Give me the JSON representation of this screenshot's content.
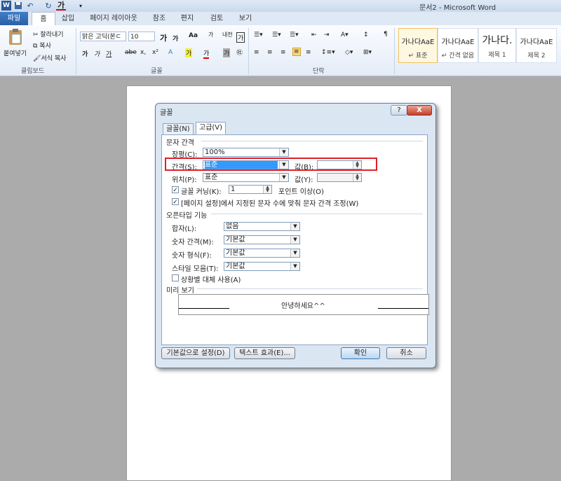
{
  "window": {
    "title": "문서2 - Microsoft Word"
  },
  "quick_access": {
    "icons": [
      "word-logo-icon",
      "save-icon",
      "undo-icon",
      "redo-icon",
      "font-color-icon",
      "customize-icon"
    ],
    "font_color_glyph": "가"
  },
  "ribbon_tabs": [
    "파일",
    "홈",
    "삽입",
    "페이지 레이아웃",
    "참조",
    "편지",
    "검토",
    "보기"
  ],
  "ribbon": {
    "clipboard": {
      "paste": "붙여넣기",
      "cut": "잘라내기",
      "copy": "복사",
      "format_painter": "서식 복사",
      "group": "클립보드"
    },
    "font": {
      "font_name": "맑은 고딕(본ㄷ",
      "font_size": "10",
      "group": "글꼴",
      "bold": "가",
      "italic": "가",
      "underline": "가",
      "strike": "abe",
      "sub": "x,",
      "sup": "x²",
      "grow": "가",
      "shrink": "가",
      "aa": "Aa",
      "clear": "가",
      "hanja": "내천",
      "border": "가",
      "shade": "가",
      "circle": "㊓",
      "color": "가",
      "highlight": "가"
    },
    "paragraph": {
      "group": "단락"
    },
    "styles": [
      {
        "sample": "가나다AaE",
        "name": "↵ 표준"
      },
      {
        "sample": "가나다AaE",
        "name": "↵ 간격 없음"
      },
      {
        "sample": "가나다.",
        "name": "제목 1"
      },
      {
        "sample": "가나다AaE",
        "name": "제목 2"
      }
    ]
  },
  "dialog": {
    "title": "글꼴",
    "help": "?",
    "close": "X",
    "tabs": [
      "글꼴(N)",
      "고급(V)"
    ],
    "char_spacing": {
      "section": "문자 간격",
      "scale_label": "장평(C):",
      "scale_value": "100%",
      "spacing_label": "간격(S):",
      "spacing_value": "표준",
      "spacing_by_label": "값(B):",
      "spacing_by_value": "",
      "position_label": "위치(P):",
      "position_value": "표준",
      "position_by_label": "값(Y):",
      "position_by_value": "",
      "kerning_label": "글꼴 커닝(K):",
      "kerning_value": "1",
      "kerning_suffix": "포인트 이상(O)",
      "grid_label": "[페이지 설정]에서 지정된 문자 수에 맞춰 문자 간격 조정(W)"
    },
    "opentype": {
      "section": "오픈타입 기능",
      "ligature_label": "합자(L):",
      "ligature_value": "없음",
      "num_spacing_label": "숫자 간격(M):",
      "num_spacing_value": "기본값",
      "num_form_label": "숫자 형식(F):",
      "num_form_value": "기본값",
      "style_set_label": "스타일 모음(T):",
      "style_set_value": "기본값",
      "contextual_label": "상황별 대체 사용(A)"
    },
    "preview": {
      "section": "미리 보기",
      "text": "안녕하세요^^"
    },
    "buttons": {
      "default": "기본값으로 설정(D)",
      "effects": "텍스트 효과(E)...",
      "ok": "확인",
      "cancel": "취소"
    }
  }
}
